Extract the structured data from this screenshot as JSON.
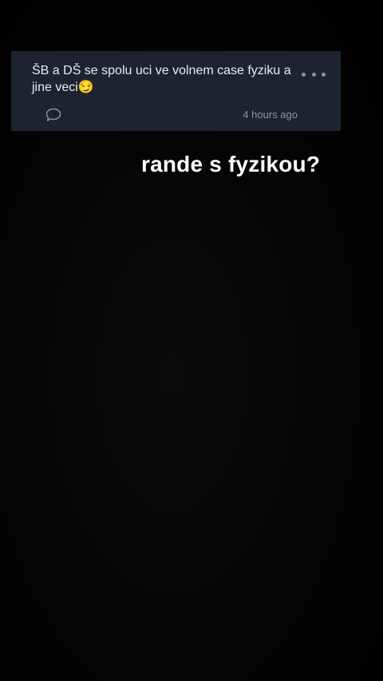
{
  "post": {
    "text": "ŠB a DŠ se spolu uci ve volnem case fyziku a jine veci😏",
    "timestamp": "4 hours ago",
    "more_icon": "more-dots-icon",
    "comment_icon": "comment-bubble-icon"
  },
  "story": {
    "caption": "rande s fyzikou?"
  },
  "colors": {
    "background": "#000000",
    "card": "#1d2430",
    "card_text": "#e9ecf0",
    "muted": "#8a94a3",
    "caption": "#ffffff"
  }
}
